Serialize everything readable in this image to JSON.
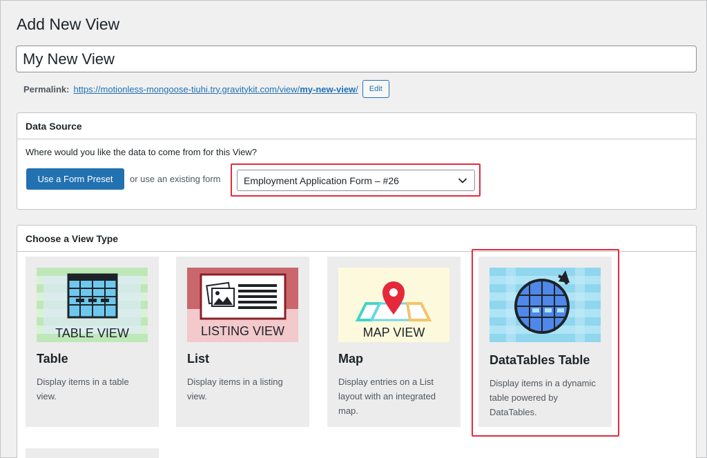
{
  "page": {
    "title": "Add New View"
  },
  "title_field": {
    "value": "My New View"
  },
  "permalink": {
    "label": "Permalink:",
    "url_base": "https://motionless-mongoose-tiuhi.try.gravitykit.com/view/",
    "slug": "my-new-view",
    "url_end": "/",
    "edit_label": "Edit"
  },
  "data_source": {
    "heading": "Data Source",
    "question": "Where would you like the data to come from for this View?",
    "preset_button": "Use a Form Preset",
    "or_text": "or use an existing form",
    "selected_form": "Employment Application Form – #26"
  },
  "view_type": {
    "heading": "Choose a View Type",
    "cards": [
      {
        "thumb_label": "TABLE VIEW",
        "title": "Table",
        "desc": "Display items in a table view."
      },
      {
        "thumb_label": "LISTING VIEW",
        "title": "List",
        "desc": "Display items in a listing view."
      },
      {
        "thumb_label": "MAP VIEW",
        "title": "Map",
        "desc": "Display entries on a List layout with an integrated map."
      },
      {
        "thumb_label": "",
        "title": "DataTables Table",
        "desc": "Display items in a dynamic table powered by DataTables."
      }
    ]
  },
  "colors": {
    "accent": "#2271b1",
    "highlight": "#e5293a",
    "card_bg": "#ececec"
  }
}
